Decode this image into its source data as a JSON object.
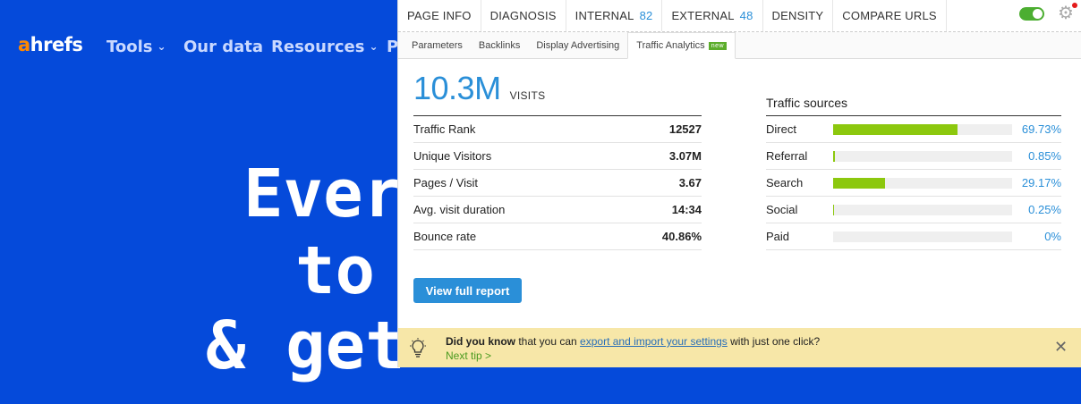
{
  "site": {
    "logo_accent": "a",
    "logo_rest": "hrefs",
    "nav": [
      {
        "label": "Tools",
        "chevron": true
      },
      {
        "label": "Our data",
        "chevron": false
      },
      {
        "label": "Resources",
        "chevron": true
      },
      {
        "label": "P",
        "chevron": false
      }
    ],
    "hero": [
      "Every",
      "to r",
      "& get"
    ]
  },
  "extension": {
    "top_tabs": [
      {
        "label": "PAGE INFO",
        "count": ""
      },
      {
        "label": "DIAGNOSIS",
        "count": ""
      },
      {
        "label": "INTERNAL",
        "count": "82"
      },
      {
        "label": "EXTERNAL",
        "count": "48"
      },
      {
        "label": "DENSITY",
        "count": ""
      },
      {
        "label": "COMPARE URLS",
        "count": ""
      }
    ],
    "sub_tabs": [
      {
        "label": "Parameters",
        "active": false
      },
      {
        "label": "Backlinks",
        "active": false
      },
      {
        "label": "Display Advertising",
        "active": false
      },
      {
        "label": "Traffic Analytics",
        "active": true,
        "badge": "new"
      }
    ],
    "visits": {
      "value": "10.3M",
      "label": "VISITS"
    },
    "stats": [
      {
        "label": "Traffic Rank",
        "value": "12527"
      },
      {
        "label": "Unique Visitors",
        "value": "3.07M"
      },
      {
        "label": "Pages / Visit",
        "value": "3.67"
      },
      {
        "label": "Avg. visit duration",
        "value": "14:34"
      },
      {
        "label": "Bounce rate",
        "value": "40.86%"
      }
    ],
    "sources_title": "Traffic sources",
    "sources": [
      {
        "name": "Direct",
        "percent": 69.73,
        "label": "69.73%"
      },
      {
        "name": "Referral",
        "percent": 0.85,
        "label": "0.85%"
      },
      {
        "name": "Search",
        "percent": 29.17,
        "label": "29.17%"
      },
      {
        "name": "Social",
        "percent": 0.25,
        "label": "0.25%"
      },
      {
        "name": "Paid",
        "percent": 0,
        "label": "0%"
      }
    ],
    "report_button": "View full report",
    "tip": {
      "bold": "Did you know",
      "pre": " that you can ",
      "link": "export and import your settings",
      "post": " with just one click?",
      "next": "Next tip >"
    }
  },
  "colors": {
    "accent_blue": "#2a8fd8",
    "bar_green": "#8cc80e",
    "site_bg": "#054ada",
    "logo_orange": "#ff8800"
  },
  "icons": {
    "gear": "gear-icon",
    "close": "close-icon",
    "bulb": "lightbulb-icon",
    "toggle": "toggle-on"
  }
}
